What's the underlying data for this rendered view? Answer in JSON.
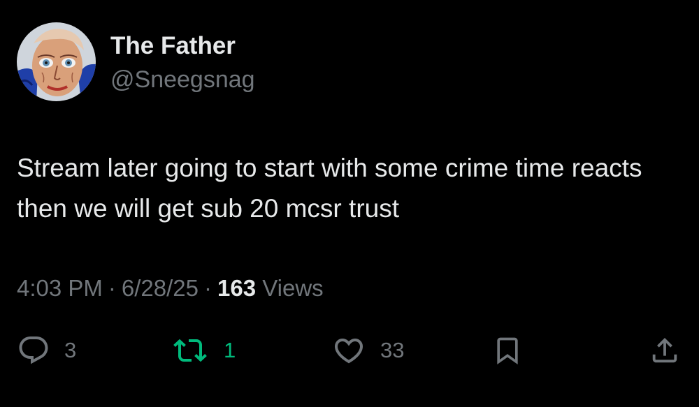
{
  "user": {
    "display_name": "The Father",
    "handle": "@Sneegsnag"
  },
  "tweet": {
    "text": "Stream later going to start with some crime time reacts then we will get sub 20 mcsr trust",
    "time": "4:03 PM",
    "date": "6/28/25",
    "separator": "·",
    "views_count": "163",
    "views_label": "Views"
  },
  "actions": {
    "replies": "3",
    "retweets": "1",
    "likes": "33"
  },
  "icons": {
    "reply": "reply-icon",
    "retweet": "retweet-icon",
    "like": "heart-icon",
    "bookmark": "bookmark-icon",
    "share": "share-icon"
  },
  "colors": {
    "background": "#000000",
    "text": "#e7e9ea",
    "secondary": "#71767b",
    "retweet_active": "#00ba7c"
  }
}
